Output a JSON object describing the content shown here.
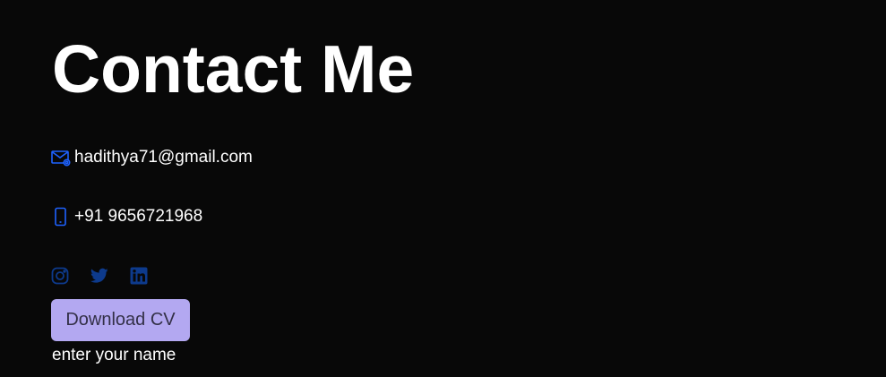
{
  "page": {
    "title": "Contact Me"
  },
  "contact": {
    "email": {
      "icon": "mail-icon",
      "text": "hadithya71@gmail.com"
    },
    "phone": {
      "icon": "phone-icon",
      "text": "+91 9656721968"
    }
  },
  "socials": [
    {
      "icon": "instagram-icon"
    },
    {
      "icon": "twitter-icon"
    },
    {
      "icon": "linkedin-icon"
    }
  ],
  "cv_button": {
    "label": "Download CV"
  },
  "form": {
    "name_label": "enter your name"
  },
  "colors": {
    "background": "#080808",
    "text": "#ffffff",
    "icon_accent": "#1e62ff",
    "social_icon": "#0d3a8c",
    "button_bg": "#b3a8f1",
    "button_text": "#333047"
  }
}
